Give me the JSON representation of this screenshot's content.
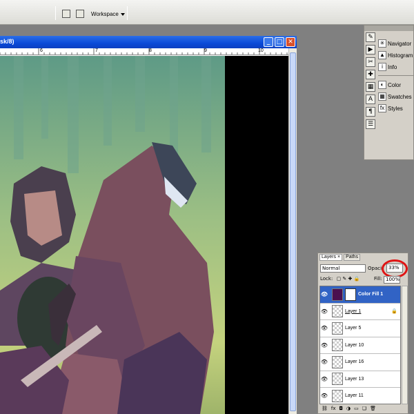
{
  "toolbar": {
    "workspace_label": "Workspace"
  },
  "document": {
    "title_fragment": "sk/8)",
    "ruler_labels": [
      "6",
      "7",
      "8",
      "9",
      "10"
    ],
    "minimize": "_",
    "maximize": "□",
    "close": "✕"
  },
  "panels": {
    "items": [
      {
        "label": "Navigator",
        "icon": "navigator-icon"
      },
      {
        "label": "Histogram",
        "icon": "histogram-icon"
      },
      {
        "label": "Info",
        "icon": "info-icon"
      },
      {
        "label": "Color",
        "icon": "color-icon"
      },
      {
        "label": "Swatches",
        "icon": "swatches-icon"
      },
      {
        "label": "Styles",
        "icon": "styles-icon"
      }
    ]
  },
  "layers_panel": {
    "tabs": [
      "Layers ×",
      "Paths"
    ],
    "blend_mode": "Normal",
    "opacity_label": "Opacit",
    "opacity_value": "33%",
    "lock_label": "Lock:",
    "fill_label": "Fill:",
    "fill_value": "100%",
    "layers": [
      {
        "name": "Color Fill 1",
        "selected": true
      },
      {
        "name": "Layer 1",
        "selected": false,
        "locked": true
      },
      {
        "name": "Layer 5",
        "selected": false
      },
      {
        "name": "Layer 10",
        "selected": false
      },
      {
        "name": "Layer 16",
        "selected": false
      },
      {
        "name": "Layer 13",
        "selected": false
      },
      {
        "name": "Layer 11",
        "selected": false
      }
    ]
  },
  "colors": {
    "title_bar": "#0a4ad8",
    "selected_layer": "#3163c5",
    "highlight_circle": "#e01414"
  }
}
